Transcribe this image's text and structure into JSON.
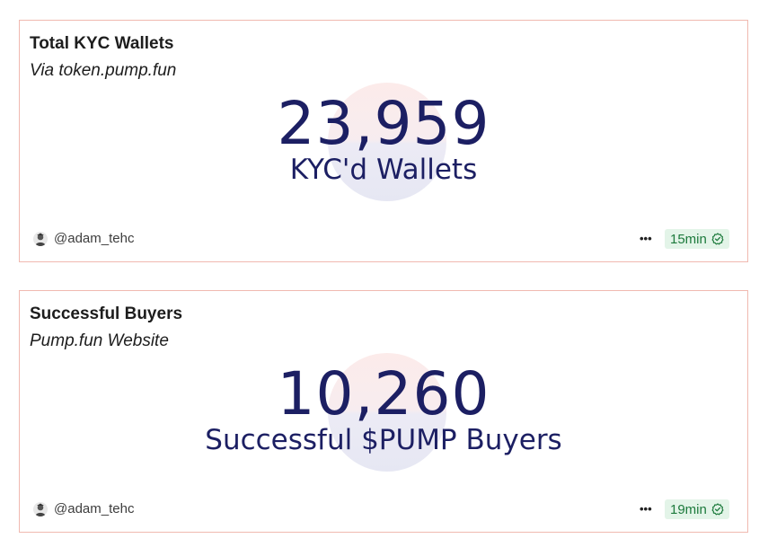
{
  "cards": [
    {
      "title": "Total KYC Wallets",
      "subtitle": "Via token.pump.fun",
      "value": "23,959",
      "label": "KYC'd Wallets",
      "author": "@adam_tehc",
      "more_icon": "more-horizontal-icon",
      "refresh": "15min",
      "status_icon": "check-circle-icon"
    },
    {
      "title": "Successful Buyers",
      "subtitle": "Pump.fun Website",
      "value": "10,260",
      "label": "Successful $PUMP Buyers",
      "author": "@adam_tehc",
      "more_icon": "more-horizontal-icon",
      "refresh": "19min",
      "status_icon": "check-circle-icon"
    }
  ],
  "colors": {
    "card_border": "#f0b9b0",
    "value_text": "#1c1f63",
    "badge_bg": "#e3f4e8",
    "badge_text": "#1d7a3c"
  }
}
